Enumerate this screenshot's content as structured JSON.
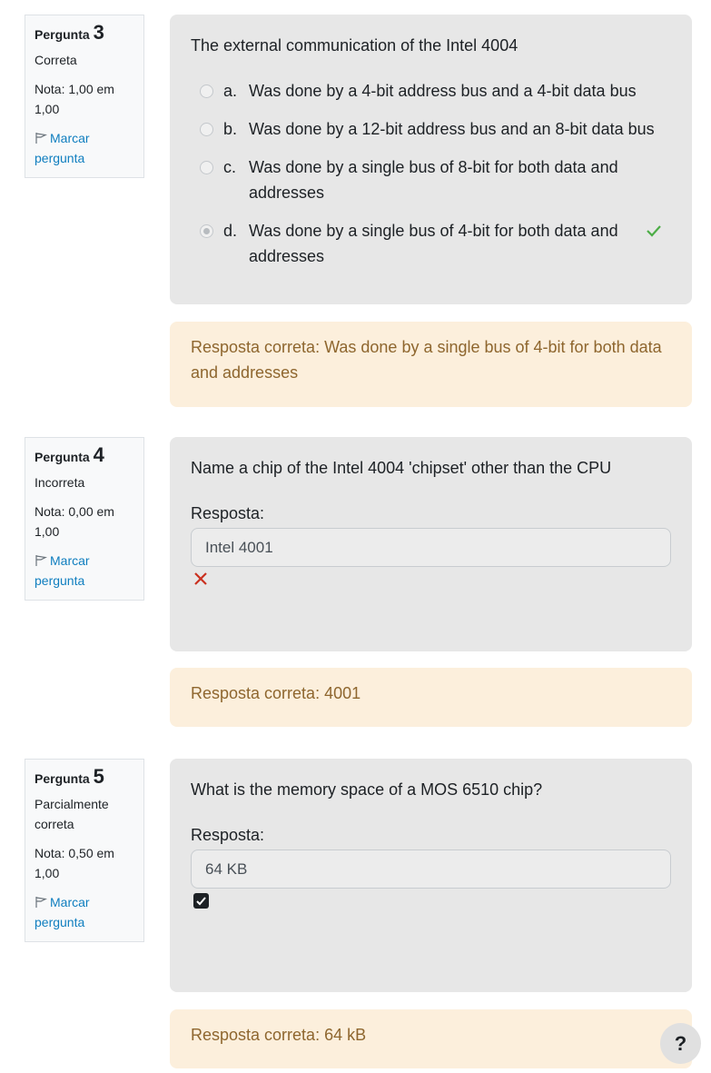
{
  "questions": [
    {
      "label": "Pergunta",
      "number": "3",
      "state": "Correta",
      "grade": "Nota: 1,00 em 1,00",
      "flag": "Marcar pergunta",
      "text": "The external communication of the Intel 4004",
      "options": [
        {
          "letter": "a.",
          "text": "Was done by a 4-bit address bus and a 4-bit data bus"
        },
        {
          "letter": "b.",
          "text": "Was done by a 12-bit address bus and an 8-bit data bus"
        },
        {
          "letter": "c.",
          "text": "Was done by a single bus of 8-bit for both data and addresses"
        },
        {
          "letter": "d.",
          "text": "Was done by a single bus of 4-bit for both data and addresses"
        }
      ],
      "feedback": "Resposta correta: Was done by a single bus of 4-bit for both data and addresses"
    },
    {
      "label": "Pergunta",
      "number": "4",
      "state": "Incorreta",
      "grade": "Nota: 0,00 em 1,00",
      "flag": "Marcar pergunta",
      "text": "Name a chip of the Intel 4004 'chipset' other than the CPU",
      "answer_label": "Resposta:",
      "answer_value": "Intel 4001",
      "feedback": "Resposta correta: 4001"
    },
    {
      "label": "Pergunta",
      "number": "5",
      "state": "Parcialmente correta",
      "grade": "Nota: 0,50 em 1,00",
      "flag": "Marcar pergunta",
      "text": "What is the memory space of a MOS 6510 chip?",
      "answer_label": "Resposta:",
      "answer_value": "64 KB",
      "feedback": "Resposta correta: 64 kB"
    }
  ],
  "help_button": "?",
  "colors": {
    "correct": "#357a32",
    "incorrect": "#ca3120",
    "link": "#0f7ebf",
    "feedback_text": "#8e662e",
    "feedback_bg": "#fcefdc"
  },
  "icons": {
    "flag": "flag-icon",
    "correct": "checkmark-icon",
    "incorrect": "cross-icon",
    "partial": "checkbox-check-icon"
  }
}
